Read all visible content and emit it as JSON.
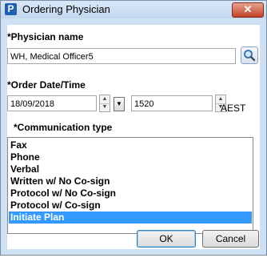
{
  "window": {
    "app_icon_letter": "P",
    "title": "Ordering Physician",
    "close_glyph": "✕"
  },
  "physician": {
    "label": "*Physician name",
    "value": "WH, Medical  Officer5",
    "search_icon": "magnifier-icon"
  },
  "order": {
    "label": "*Order Date/Time",
    "date": "18/09/2018",
    "time": "1520",
    "timezone": "AEST"
  },
  "communication": {
    "label": "*Communication type",
    "items": [
      "Fax",
      "Phone",
      "Verbal",
      "Written w/ No Co-sign",
      "Protocol w/ No Co-sign",
      "Protocol w/ Co-sign",
      "Initiate Plan"
    ],
    "selected": "Initiate Plan"
  },
  "buttons": {
    "ok": "OK",
    "cancel": "Cancel"
  },
  "colors": {
    "selection": "#3399ff",
    "window_frame": "#cfe0f2",
    "close_button": "#c2432a"
  }
}
